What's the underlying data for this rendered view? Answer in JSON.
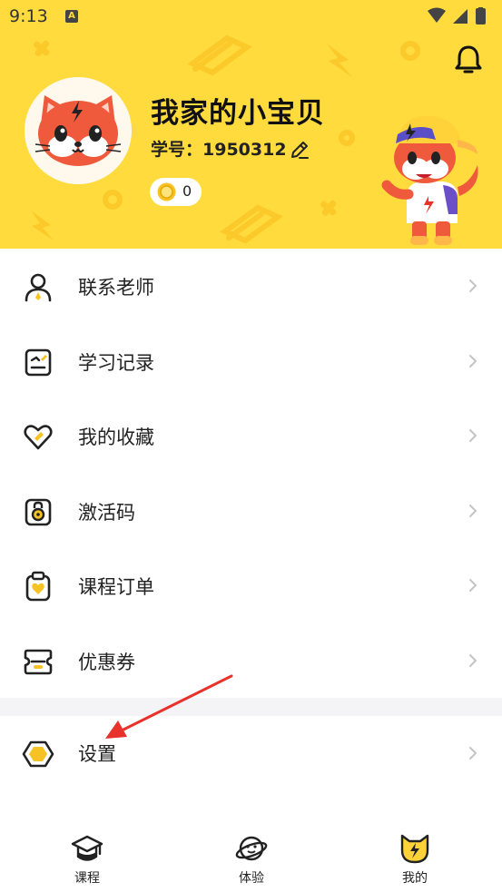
{
  "status_bar": {
    "time": "9:13",
    "notif_letter": "A"
  },
  "profile": {
    "nickname": "我家的小宝贝",
    "student_id": "学号：1950312",
    "coins": "0"
  },
  "menu": {
    "items": [
      {
        "label": "联系老师",
        "icon": "teacher-icon"
      },
      {
        "label": "学习记录",
        "icon": "study-record-icon"
      },
      {
        "label": "我的收藏",
        "icon": "heart-icon"
      },
      {
        "label": "激活码",
        "icon": "lock-icon"
      },
      {
        "label": "课程订单",
        "icon": "clipboard-icon"
      },
      {
        "label": "优惠券",
        "icon": "coupon-icon"
      }
    ],
    "settings_label": "设置"
  },
  "tabbar": {
    "tabs": [
      {
        "label": "课程",
        "icon": "graduation-cap-icon"
      },
      {
        "label": "体验",
        "icon": "planet-icon"
      },
      {
        "label": "我的",
        "icon": "fox-face-icon",
        "active": true
      }
    ]
  },
  "colors": {
    "brand_yellow": "#FFDB3D",
    "arrow_red": "#E8322B",
    "text": "#222222"
  }
}
